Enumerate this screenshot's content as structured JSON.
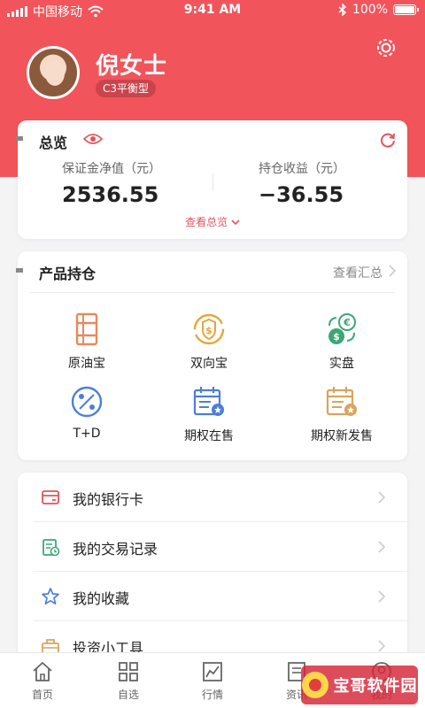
{
  "status_bar": {
    "carrier": "中国移动",
    "time": "9:41 AM",
    "battery": "100%",
    "battery_level": 1.0
  },
  "profile": {
    "name": "倪女士",
    "risk_level": "C3平衡型",
    "avatar": "avatar-photo"
  },
  "overview": {
    "title": "总览",
    "margin_label": "保证金净值（元）",
    "margin_value": "2536.55",
    "profit_label": "持仓收益（元）",
    "profit_value": "−36.55",
    "more_link": "查看总览"
  },
  "holdings": {
    "title": "产品持仓",
    "summary_link": "查看汇总",
    "products": [
      {
        "label": "原油宝",
        "icon": "oil-barrel-icon"
      },
      {
        "label": "双向宝",
        "icon": "two-way-coin-icon"
      },
      {
        "label": "实盘",
        "icon": "currency-exchange-icon"
      },
      {
        "label": "T+D",
        "icon": "percent-icon"
      },
      {
        "label": "期权在售",
        "icon": "calendar-badge-icon"
      },
      {
        "label": "期权新发售",
        "icon": "calendar-new-icon"
      }
    ]
  },
  "menu": [
    {
      "label": "我的银行卡",
      "icon": "bank-card-icon"
    },
    {
      "label": "我的交易记录",
      "icon": "trade-record-icon"
    },
    {
      "label": "我的收藏",
      "icon": "star-icon"
    },
    {
      "label": "投资小工具",
      "icon": "toolbox-icon"
    }
  ],
  "tabbar": [
    {
      "label": "首页",
      "icon": "home-icon"
    },
    {
      "label": "自选",
      "icon": "grid-icon"
    },
    {
      "label": "行情",
      "icon": "chart-icon"
    },
    {
      "label": "资讯",
      "icon": "news-icon"
    },
    {
      "label": "我的",
      "icon": "profile-icon"
    }
  ],
  "watermark": {
    "text": "宝哥软件园"
  },
  "colors": {
    "brand_red": "#f2545b",
    "accent_red": "#e0555b",
    "oil_orange": "#e68a5c",
    "gold": "#e3a73a",
    "green": "#3aa876",
    "blue": "#4b7fd6",
    "tan": "#d9a45c"
  }
}
